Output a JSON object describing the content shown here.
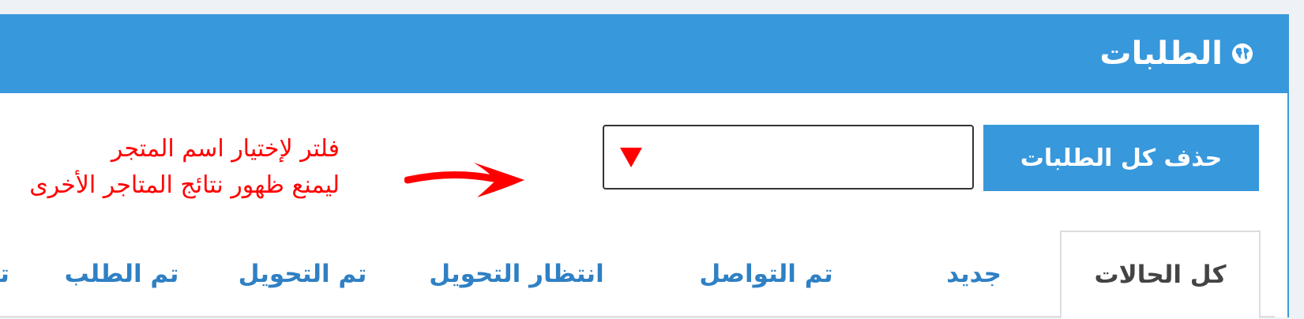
{
  "header": {
    "title": "الطلبات",
    "icon": "globe-icon",
    "background_color": "#3898dc"
  },
  "toolbar": {
    "delete_all_label": "حذف كل الطلبات",
    "store_filter_value": ""
  },
  "annotation": {
    "line1": "فلتر لإختيار اسم المتجر",
    "line2": "ليمنع ظهور نتائج المتاجر الأخرى",
    "color": "#ff0000"
  },
  "tabs": [
    {
      "label": "كل الحالات",
      "active": true
    },
    {
      "label": "جديد",
      "active": false
    },
    {
      "label": "تم التواصل",
      "active": false
    },
    {
      "label": "انتظار التحويل",
      "active": false
    },
    {
      "label": "تم التحويل",
      "active": false
    },
    {
      "label": "تم الطلب",
      "active": false
    },
    {
      "label": "تم",
      "active": false
    }
  ]
}
